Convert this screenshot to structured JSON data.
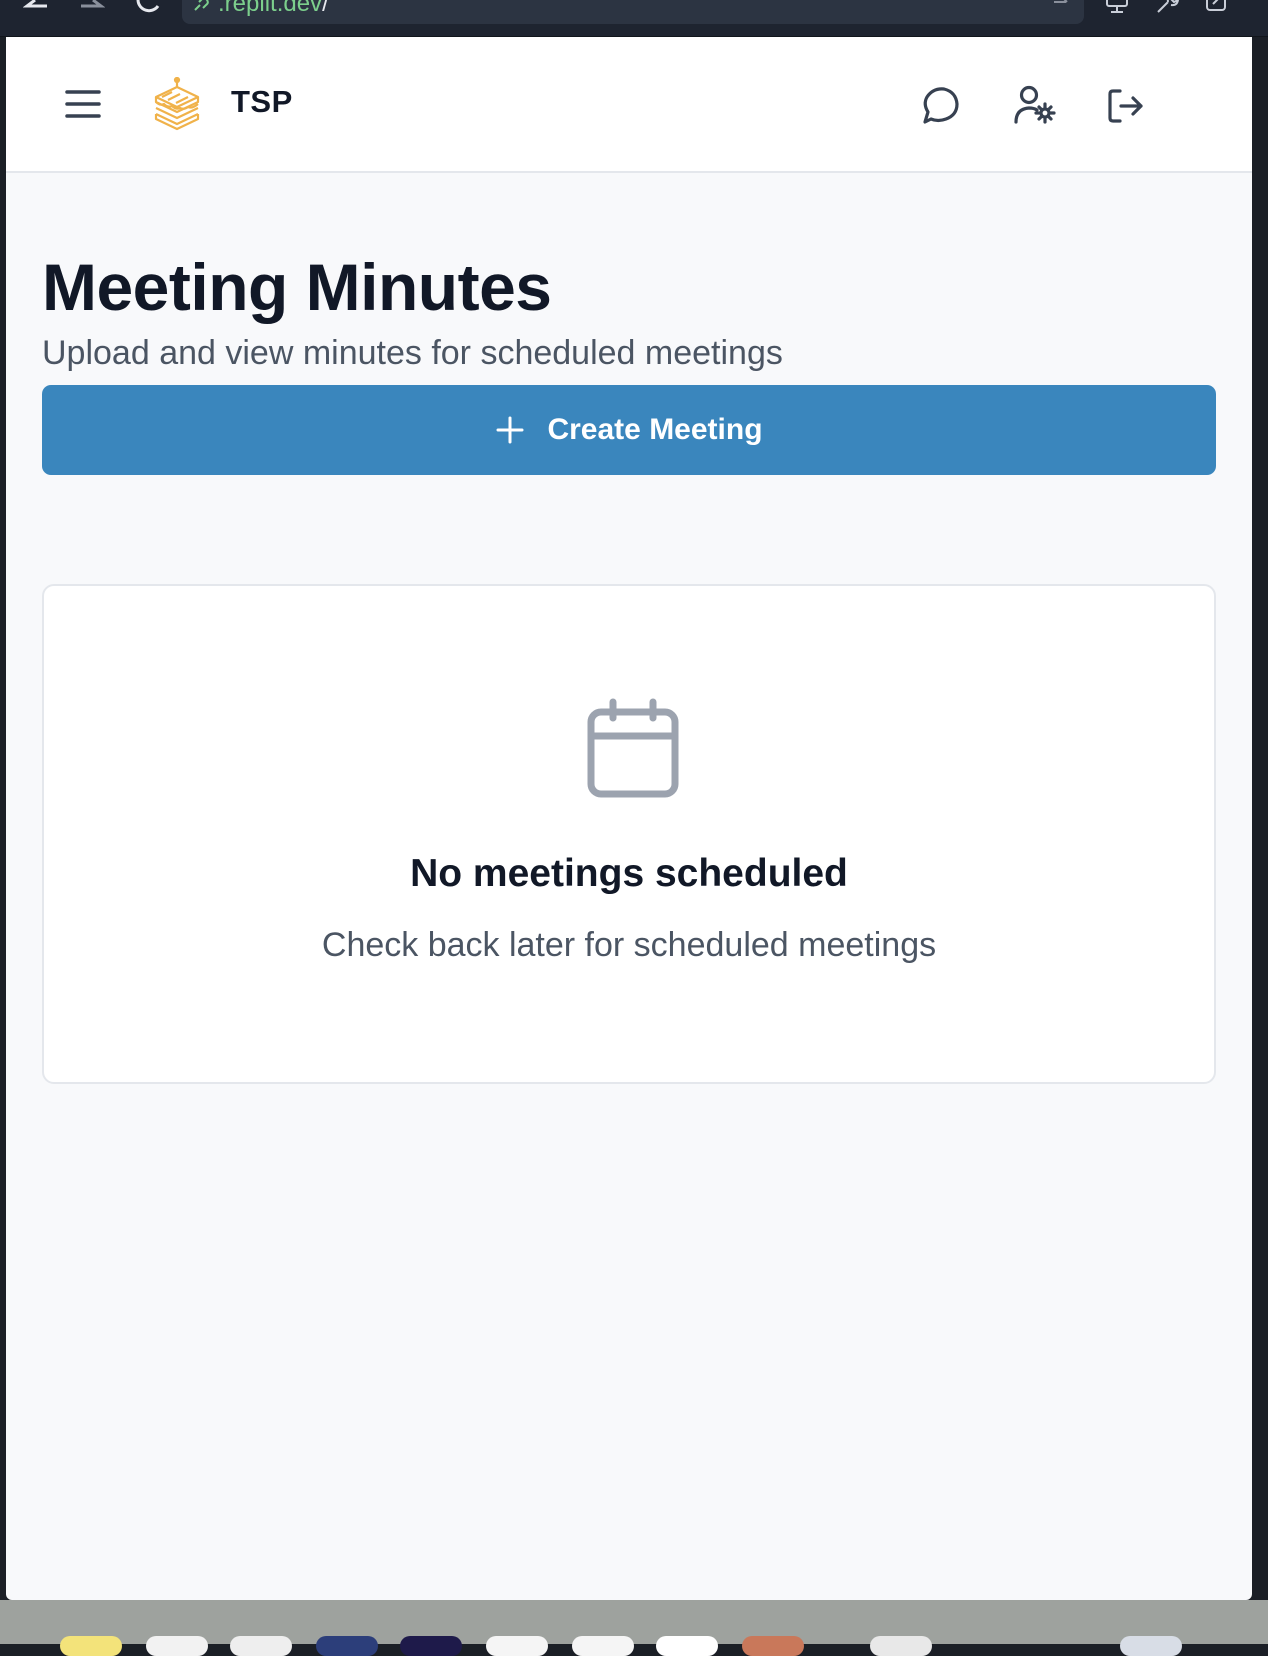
{
  "browser": {
    "url_text": ".replit.dev",
    "url_suffix": "/"
  },
  "header": {
    "brand": "TSP"
  },
  "page": {
    "title": "Meeting Minutes",
    "subtitle": "Upload and view minutes for scheduled meetings",
    "create_button_label": "Create Meeting"
  },
  "empty_state": {
    "title": "No meetings scheduled",
    "text": "Check back later for scheduled meetings"
  },
  "colors": {
    "primary": "#3a86bd",
    "logo": "#f0b24a",
    "heading": "#111827",
    "muted_text": "#4b5563",
    "icon_gray": "#9ca3af",
    "header_icon": "#374151"
  }
}
